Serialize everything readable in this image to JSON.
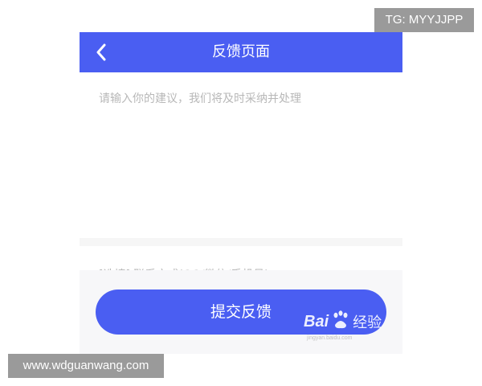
{
  "header": {
    "title": "反馈页面",
    "back_icon": "chevron-left-icon"
  },
  "feedback": {
    "placeholder": "请输入你的建议，我们将及时采纳并处理",
    "value": ""
  },
  "contact": {
    "placeholder": "[选填] 联系方式(QQ/微信/手机号)",
    "value": ""
  },
  "submit": {
    "label": "提交反馈"
  },
  "watermarks": {
    "top_right": "TG: MYYJJPP",
    "bottom_left": "www.wdguanwang.com",
    "baidu_text": "Bai",
    "baidu_suffix": "经验",
    "baidu_sub": "jingyan.baidu.com"
  },
  "colors": {
    "accent": "#4a5ef2",
    "placeholder": "#b8b8b8",
    "panel": "#f7f7f9",
    "watermark_bg": "#9a9a9a"
  }
}
